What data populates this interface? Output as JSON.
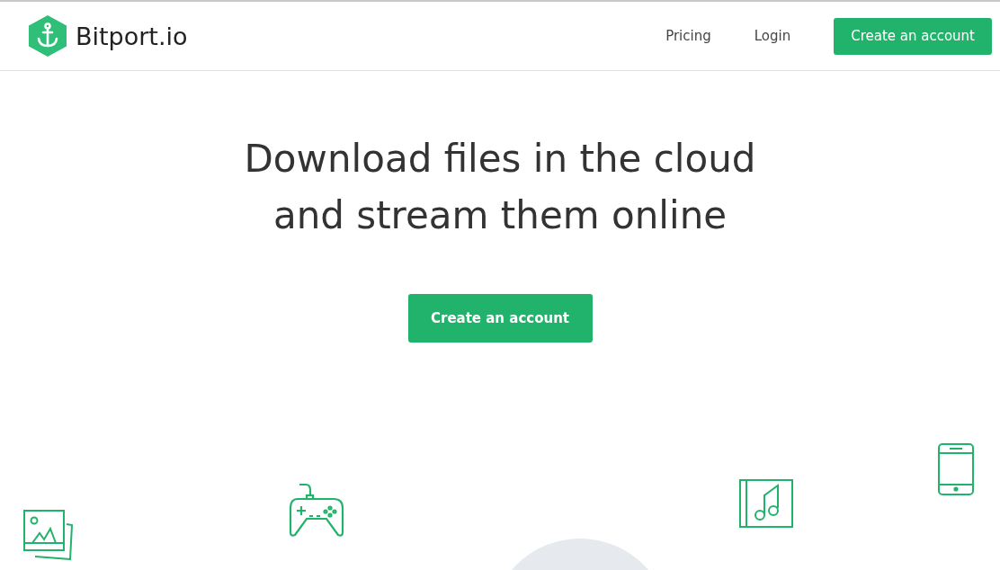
{
  "header": {
    "brand": "Bitport.io",
    "nav": [
      "Pricing",
      "Login"
    ],
    "cta": "Create an account"
  },
  "hero": {
    "title_lines": [
      "Download files in the cloud",
      "and stream them online"
    ],
    "cta": "Create an account"
  }
}
